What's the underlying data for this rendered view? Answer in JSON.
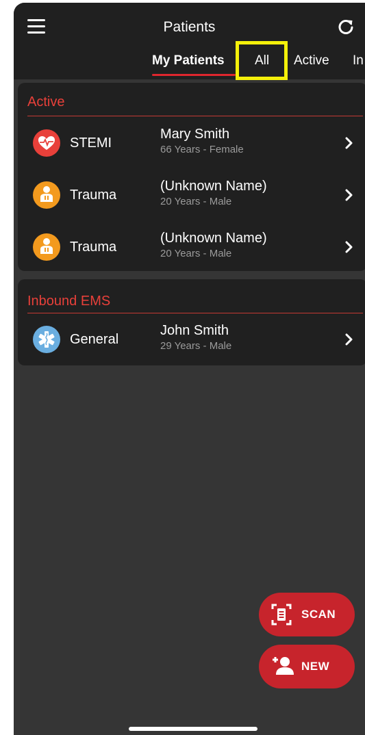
{
  "header": {
    "title": "Patients",
    "tabs": [
      {
        "label": "My Patients",
        "selected": true
      },
      {
        "label": "All",
        "selected": false
      },
      {
        "label": "Active",
        "selected": false
      },
      {
        "label": "In",
        "selected": false
      }
    ],
    "menu_icon": "hamburger-menu-icon",
    "refresh_icon": "refresh-icon"
  },
  "sections": [
    {
      "title": "Active",
      "patients": [
        {
          "type": "STEMI",
          "icon": "heart-pulse-icon",
          "icon_color": "#e8403a",
          "name": "Mary Smith",
          "details": "66 Years - Female"
        },
        {
          "type": "Trauma",
          "icon": "injured-person-icon",
          "icon_color": "#f39a1e",
          "name": "(Unknown Name)",
          "details": "20 Years - Male"
        },
        {
          "type": "Trauma",
          "icon": "injured-person-icon",
          "icon_color": "#f39a1e",
          "name": "(Unknown Name)",
          "details": "20 Years - Male"
        }
      ]
    },
    {
      "title": "Inbound EMS",
      "patients": [
        {
          "type": "General",
          "icon": "star-of-life-icon",
          "icon_color": "#6aaee0",
          "name": "John Smith",
          "details": "29 Years - Male"
        }
      ]
    }
  ],
  "actions": {
    "scan_label": "SCAN",
    "new_label": "NEW",
    "accent": "#c7242c"
  },
  "colors": {
    "section_title": "#e8403a",
    "tab_underline": "#e0262e",
    "highlight": "#f4f00a"
  }
}
